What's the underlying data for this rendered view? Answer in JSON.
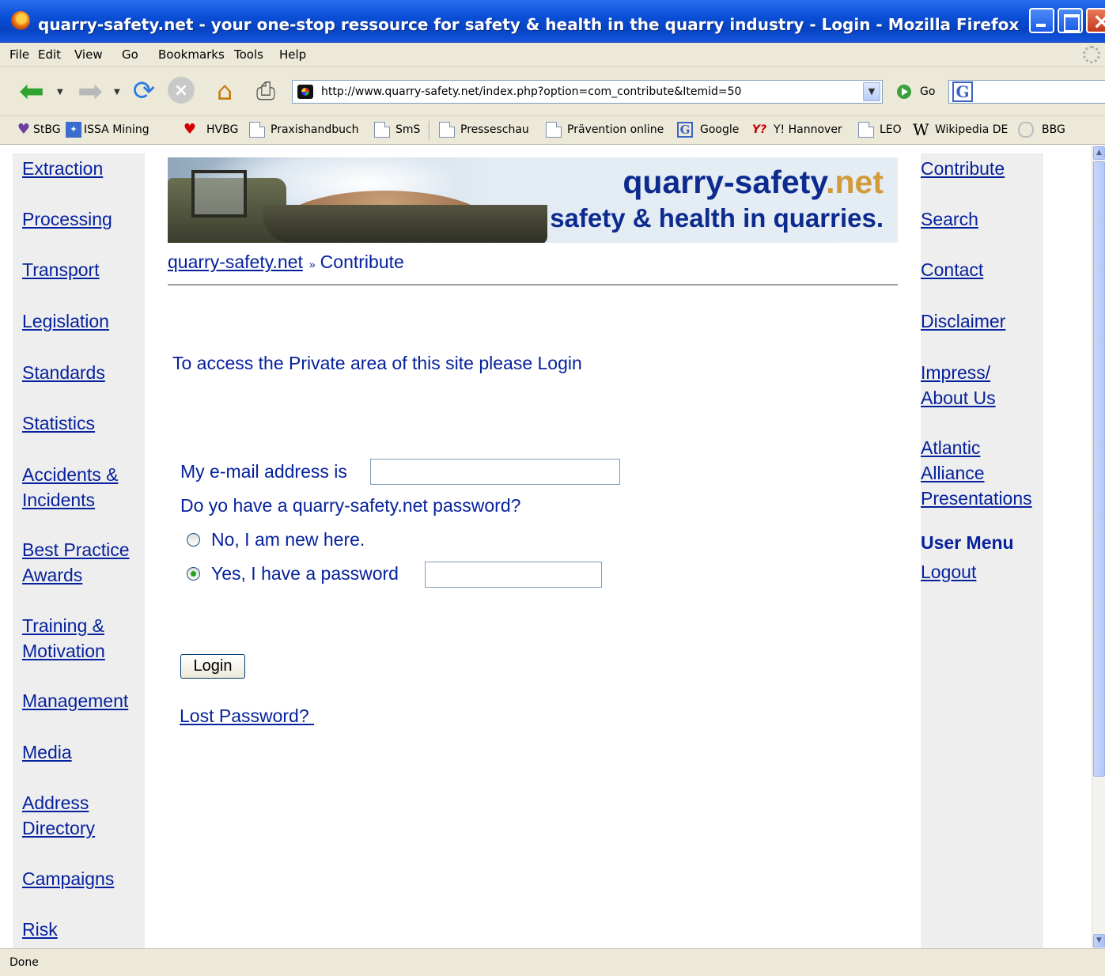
{
  "window": {
    "title": "quarry-safety.net - your one-stop ressource for safety & health in the quarry industry - Login - Mozilla Firefox"
  },
  "menu": [
    "File",
    "Edit",
    "View",
    "Go",
    "Bookmarks",
    "Tools",
    "Help"
  ],
  "toolbar": {
    "url": "http://www.quarry-safety.net/index.php?option=com_contribute&Itemid=50",
    "go_label": "Go"
  },
  "bookmarks": [
    "StBG",
    "ISSA Mining",
    "HVBG",
    "Praxishandbuch",
    "SmS",
    "Presseschau",
    "Prävention online",
    "Google",
    "Y! Hannover",
    "LEO",
    "Wikipedia DE",
    "BBG"
  ],
  "left_nav": {
    "extraction": "Extraction",
    "processing": "Processing",
    "transport": "Transport",
    "legislation": "Legislation",
    "standards": "Standards",
    "statistics": "Statistics",
    "accidents": [
      "Accidents &",
      "Incidents"
    ],
    "best_practice": [
      "Best Practice",
      "Awards"
    ],
    "training": [
      "Training &",
      "Motivation"
    ],
    "management": "Management",
    "media": "Media",
    "address": [
      "Address",
      "Directory"
    ],
    "campaigns": "Campaigns",
    "risk": "Risk"
  },
  "right_nav": {
    "contribute": "Contribute",
    "search": "Search",
    "contact": "Contact",
    "disclaimer": "Disclaimer",
    "impress": [
      "Impress/",
      "About Us"
    ],
    "atlantic": [
      "Atlantic",
      "Alliance",
      "Presentations"
    ],
    "user_menu": "User Menu",
    "logout": "Logout"
  },
  "banner": {
    "site": "quarry-safety",
    "tld": ".net",
    "tagline": "safety & health in quarries."
  },
  "breadcrumb": {
    "home": "quarry-safety.net",
    "separator": "»",
    "current": "Contribute"
  },
  "login": {
    "intro": "To access the Private area of this site please Login",
    "email_label": "My e-mail address is",
    "email_value": "",
    "password_question": "Do yo have a quarry-safety.net password?",
    "option_new": "No, I am new here.",
    "option_existing": "Yes, I have a password",
    "selected_option": "existing",
    "password_value": "",
    "login_button": "Login",
    "lost_password": "Lost Password? "
  },
  "status": {
    "text": "Done"
  }
}
